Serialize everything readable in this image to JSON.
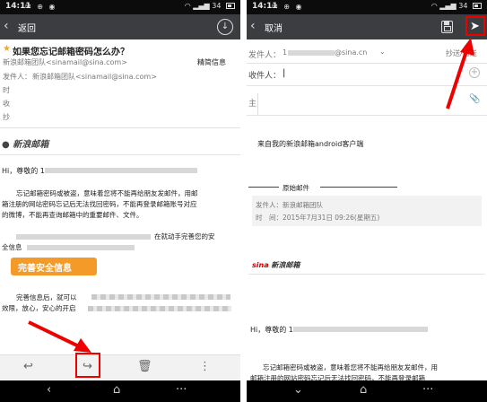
{
  "left": {
    "status": {
      "time": "14:11",
      "battery": "34"
    },
    "actionbar": {
      "back_label": "返回",
      "download_icon": "download-circle-icon"
    },
    "email": {
      "subject": "如果您忘记邮箱密码怎么办？",
      "sender_short": "新浪邮箱团队<sinamail@sina.com>",
      "summary_link": "精简信息",
      "from_label": "发件人：",
      "from_value": "新浪邮箱团队<sinamail@sina.com>",
      "time_label": "时",
      "recv_label": "收",
      "cc_label": "抄",
      "logo_text": "新浪邮箱",
      "greeting": "Hi，尊敬的 1",
      "para1_l1": "忘记邮箱密码或被盗，意味着您将不能再给朋友发邮件，用邮",
      "para1_l2": "箱注册的网站密码忘记后无法找回密码，不能再登录邮箱账号对应",
      "para1_l3": "的微博，不能再查询邮箱中的重要邮件、文件。",
      "para2_l1": "在就动手完善您的安",
      "para2_l2": "全信息",
      "button_label": "完善安全信息",
      "para3_l1": "完善信息后，就可以",
      "para3_l2": "效限，放心，安心的开启"
    },
    "toolbar": [
      "reply-icon",
      "forward-icon",
      "trash-icon",
      "more-vertical-icon"
    ]
  },
  "right": {
    "status": {
      "time": "14:11",
      "battery": "34"
    },
    "actionbar": {
      "cancel_label": "取消"
    },
    "compose": {
      "from_label": "发件人：",
      "from_prefix": "1",
      "from_suffix": "@sina.cn",
      "cc_bcc": "抄送/密送",
      "to_label": "收件人：",
      "to_cursor": "|",
      "subject_label": "主",
      "signature": "来自我的新浪邮箱android客户端",
      "original_header": "原始邮件",
      "orig_from": "发件人：新浪邮箱团队",
      "orig_time": "时　间：2015年7月31日 09:26(星期五)",
      "logo_text": "新浪邮箱",
      "greeting": "Hi，尊敬的 1",
      "para1_l1": "忘记邮箱密码或被盗，意味着您将不能再给朋友发邮件，用",
      "para1_l2": "邮箱注册的网站密码忘记后无法找回密码，不能再登录邮箱"
    }
  },
  "colors": {
    "actionbar": "#3c3d41",
    "statusbar": "#0c0c0c",
    "highlight": "#e00000",
    "orange": "#f39a28",
    "star": "#f0a830"
  }
}
